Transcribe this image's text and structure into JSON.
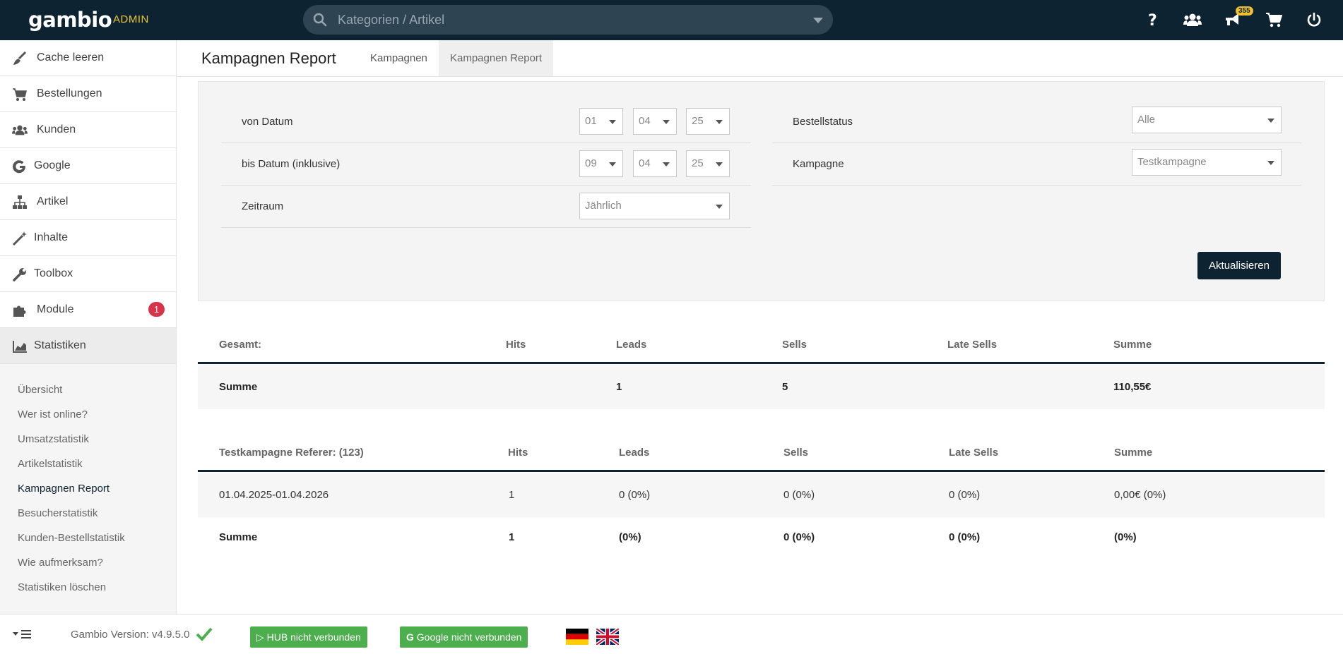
{
  "topbar": {
    "logo": "gambio",
    "admin_label": "ADMIN",
    "search_placeholder": "Kategorien / Artikel",
    "notifications_count": "355"
  },
  "sidebar": {
    "items": [
      {
        "label": "Cache leeren",
        "icon": "broom-icon"
      },
      {
        "label": "Bestellungen",
        "icon": "cart-icon"
      },
      {
        "label": "Kunden",
        "icon": "users-icon"
      },
      {
        "label": "Google",
        "icon": "google-icon"
      },
      {
        "label": "Artikel",
        "icon": "sitemap-icon"
      },
      {
        "label": "Inhalte",
        "icon": "magic-wand-icon"
      },
      {
        "label": "Toolbox",
        "icon": "wrench-icon"
      },
      {
        "label": "Module",
        "icon": "puzzle-icon",
        "badge": "1"
      },
      {
        "label": "Statistiken",
        "icon": "chart-icon"
      }
    ],
    "subitems": [
      "Übersicht",
      "Wer ist online?",
      "Umsatzstatistik",
      "Artikelstatistik",
      "Kampagnen Report",
      "Besucherstatistik",
      "Kunden-Bestellstatistik",
      "Wie aufmerksam?",
      "Statistiken löschen"
    ]
  },
  "header": {
    "title": "Kampagnen Report",
    "tabs": [
      "Kampagnen",
      "Kampagnen Report"
    ]
  },
  "filter": {
    "from_label": "von Datum",
    "from_day": "01",
    "from_month": "04",
    "from_year": "25",
    "to_label": "bis Datum (inklusive)",
    "to_day": "09",
    "to_month": "04",
    "to_year": "25",
    "period_label": "Zeitraum",
    "period_value": "Jährlich",
    "status_label": "Bestellstatus",
    "status_value": "Alle",
    "campaign_label": "Kampagne",
    "campaign_value": "Testkampagne",
    "update_button": "Aktualisieren"
  },
  "total_table": {
    "headers": [
      "Gesamt:",
      "Hits",
      "Leads",
      "Sells",
      "Late Sells",
      "Summe"
    ],
    "row": [
      "Summe",
      "",
      "1",
      "5",
      "",
      "110,55€"
    ]
  },
  "campaign_table": {
    "headers": [
      "Testkampagne Referer: (123)",
      "Hits",
      "Leads",
      "Sells",
      "Late Sells",
      "Summe"
    ],
    "rows": [
      [
        "01.04.2025-01.04.2026",
        "1",
        "0 (0%)",
        "0 (0%)",
        "0 (0%)",
        "0,00€ (0%)"
      ],
      [
        "Summe",
        "1",
        "(0%)",
        "0 (0%)",
        "0 (0%)",
        "(0%)"
      ]
    ]
  },
  "footer": {
    "version": "Gambio Version: v4.9.5.0",
    "hub_button": "HUB nicht verbunden",
    "google_button": "Google nicht verbunden"
  }
}
